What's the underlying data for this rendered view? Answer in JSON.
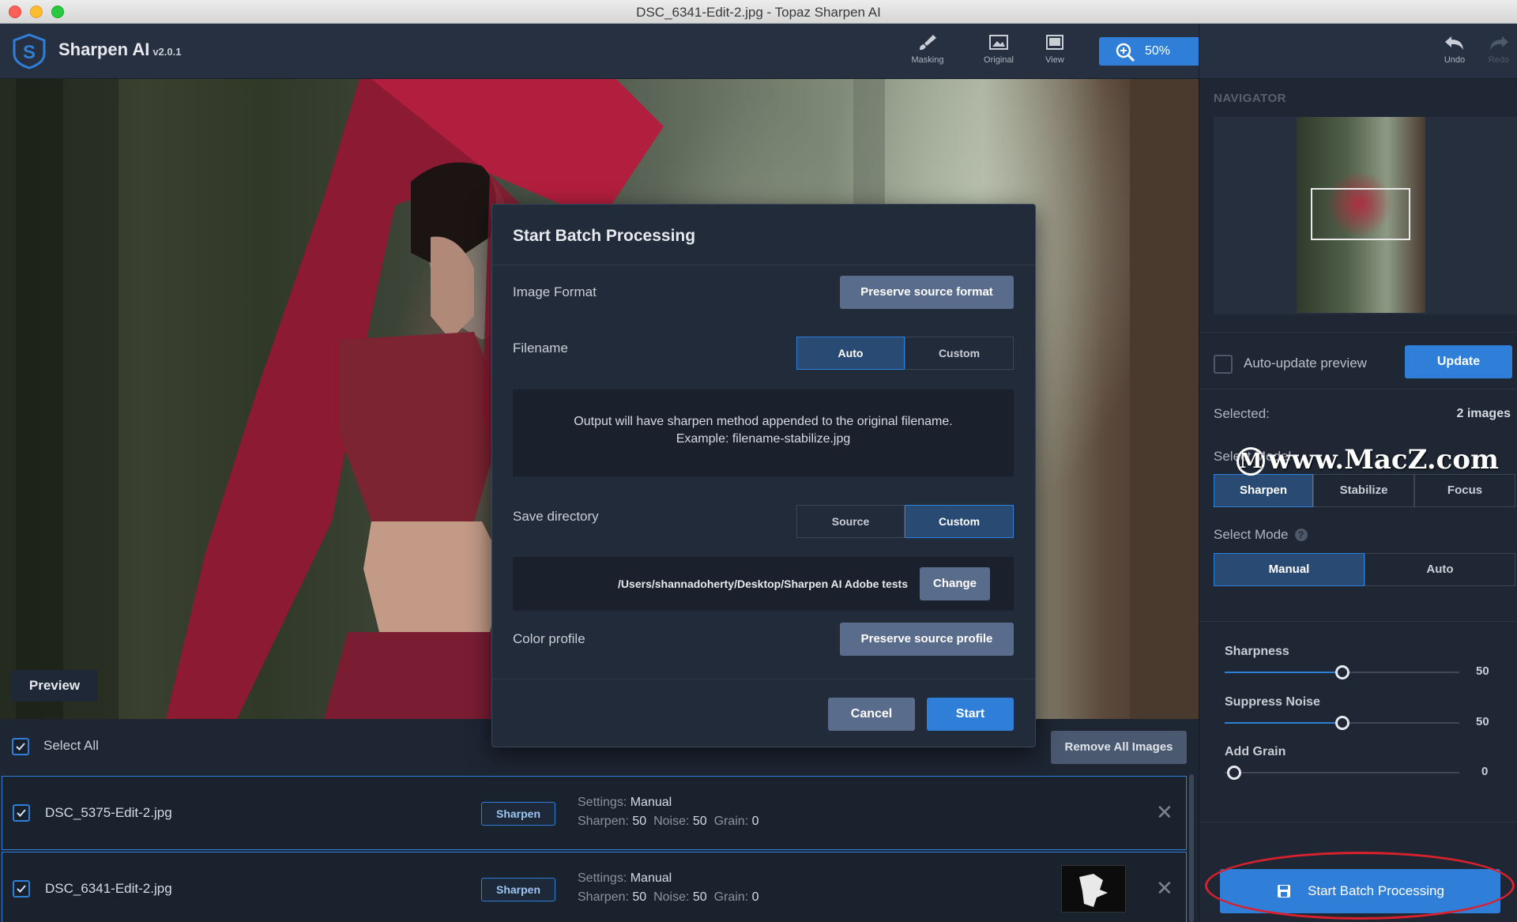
{
  "window": {
    "title": "DSC_6341-Edit-2.jpg - Topaz Sharpen AI"
  },
  "app": {
    "name": "Sharpen AI",
    "version": "v2.0.1"
  },
  "toolbar": {
    "masking": "Masking",
    "original": "Original",
    "view": "View",
    "zoom": "50%",
    "undo": "Undo",
    "redo": "Redo"
  },
  "preview": {
    "button": "Preview"
  },
  "list": {
    "select_all": "Select All",
    "remove_all": "Remove All Images",
    "files": [
      {
        "name": "DSC_5375-Edit-2.jpg",
        "method": "Sharpen",
        "settings_label": "Settings:",
        "settings_value": "Manual",
        "sharpen_label": "Sharpen:",
        "sharpen": "50",
        "noise_label": "Noise:",
        "noise": "50",
        "grain_label": "Grain:",
        "grain": "0"
      },
      {
        "name": "DSC_6341-Edit-2.jpg",
        "method": "Sharpen",
        "settings_label": "Settings:",
        "settings_value": "Manual",
        "sharpen_label": "Sharpen:",
        "sharpen": "50",
        "noise_label": "Noise:",
        "noise": "50",
        "grain_label": "Grain:",
        "grain": "0"
      }
    ]
  },
  "dialog": {
    "title": "Start Batch Processing",
    "image_format_label": "Image Format",
    "image_format_value": "Preserve source format",
    "filename_label": "Filename",
    "filename_options": [
      "Auto",
      "Custom"
    ],
    "filename_selected": "Auto",
    "info_line1": "Output will have sharpen method appended to the original filename.",
    "info_line2": "Example: filename-stabilize.jpg",
    "save_dir_label": "Save directory",
    "save_dir_options": [
      "Source",
      "Custom"
    ],
    "save_dir_selected": "Custom",
    "path": "/Users/shannadoherty/Desktop/Sharpen AI Adobe tests",
    "change": "Change",
    "color_profile_label": "Color profile",
    "color_profile_value": "Preserve source profile",
    "cancel": "Cancel",
    "start": "Start"
  },
  "panel": {
    "navigator_title": "NAVIGATOR",
    "auto_update": "Auto-update preview",
    "update": "Update",
    "selected_label": "Selected:",
    "selected_value": "2 images",
    "select_model_label": "Select Model",
    "models": [
      "Sharpen",
      "Stabilize",
      "Focus"
    ],
    "model_selected": "Sharpen",
    "select_mode_label": "Select Mode",
    "modes": [
      "Manual",
      "Auto"
    ],
    "mode_selected": "Manual",
    "sliders": [
      {
        "label": "Sharpness",
        "value": "50",
        "fraction": 0.5
      },
      {
        "label": "Suppress Noise",
        "value": "50",
        "fraction": 0.5
      },
      {
        "label": "Add Grain",
        "value": "0",
        "fraction": 0.0
      }
    ],
    "start_batch": "Start Batch Processing"
  },
  "watermark": {
    "text": "www.MacZ.com"
  },
  "colors": {
    "accent": "#2f7fd8",
    "highlight_circle": "#d9212e"
  }
}
